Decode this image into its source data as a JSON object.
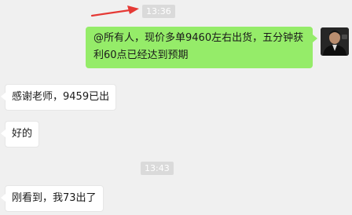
{
  "chat": {
    "timestamps": [
      "13:36",
      "13:43"
    ],
    "messages": [
      {
        "side": "right",
        "text": "@所有人，现价多单9460左右出货，五分钟获利60点已经达到预期"
      },
      {
        "side": "left",
        "text": "感谢老师，9459已出"
      },
      {
        "side": "left",
        "text": "好的"
      },
      {
        "side": "left",
        "text": "刚看到，我73出了"
      }
    ]
  },
  "colors": {
    "background": "#f0f0f0",
    "own_bubble": "#95ec69",
    "other_bubble": "#ffffff",
    "timestamp_bg": "#dadada",
    "arrow": "#e53935"
  },
  "icons": {
    "annotation": "red-arrow-icon",
    "avatar": "sender-avatar"
  }
}
